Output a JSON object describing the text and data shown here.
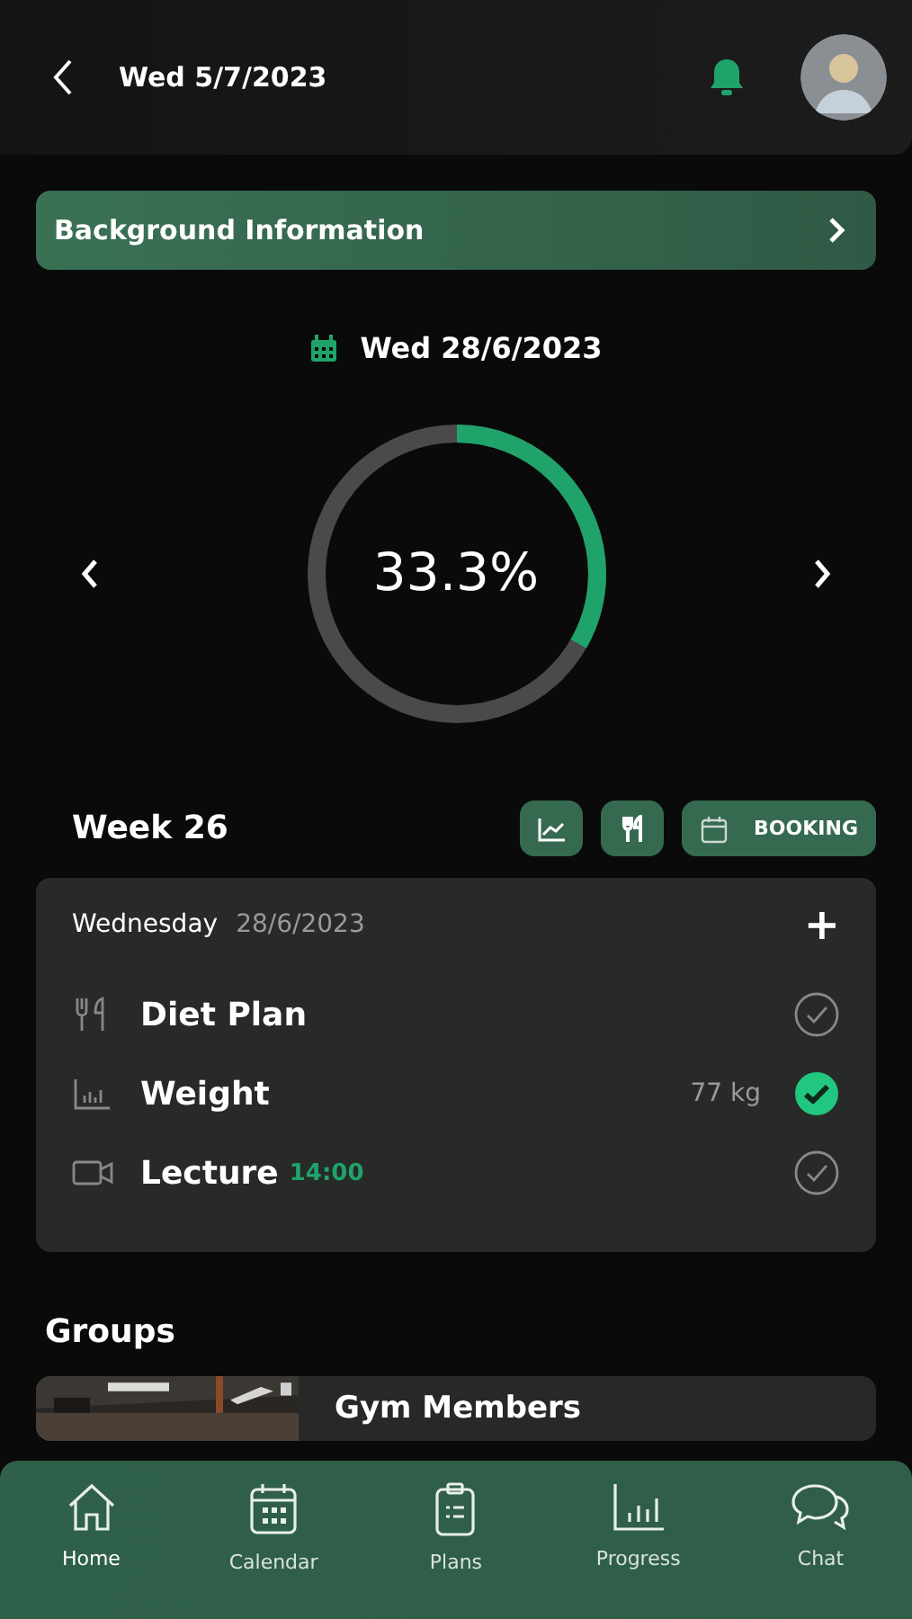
{
  "header": {
    "date": "Wed 5/7/2023",
    "notifications": true
  },
  "background_info": {
    "label": "Background Information"
  },
  "selected_date": "Wed 28/6/2023",
  "progress": {
    "level": 0.333,
    "reading": "33.3%"
  },
  "week": {
    "title": "Week 26",
    "booking": "BOOKING"
  },
  "day": {
    "weekday": "Wednesday",
    "date": "28/6/2023",
    "add": "+",
    "tasks": [
      {
        "kind": "diet",
        "name": "Diet Plan",
        "checked": false
      },
      {
        "kind": "weight",
        "name": "Weight",
        "value": "77 kg",
        "checked": true
      },
      {
        "kind": "lecture",
        "name": "Lecture",
        "time": "14:00",
        "checked": false
      }
    ]
  },
  "groups": {
    "title": "Groups",
    "items": [
      {
        "kind": "picture",
        "name": "Gym Members"
      }
    ]
  },
  "nav": [
    {
      "kind": "home",
      "label": "Home",
      "selected": true
    },
    {
      "kind": "calendar",
      "label": "Calendar",
      "selected": false
    },
    {
      "kind": "plans",
      "label": "Plans",
      "selected": false
    },
    {
      "kind": "progress",
      "label": "Progress",
      "selected": false
    },
    {
      "kind": "chat",
      "label": "Chat",
      "selected": false
    }
  ]
}
